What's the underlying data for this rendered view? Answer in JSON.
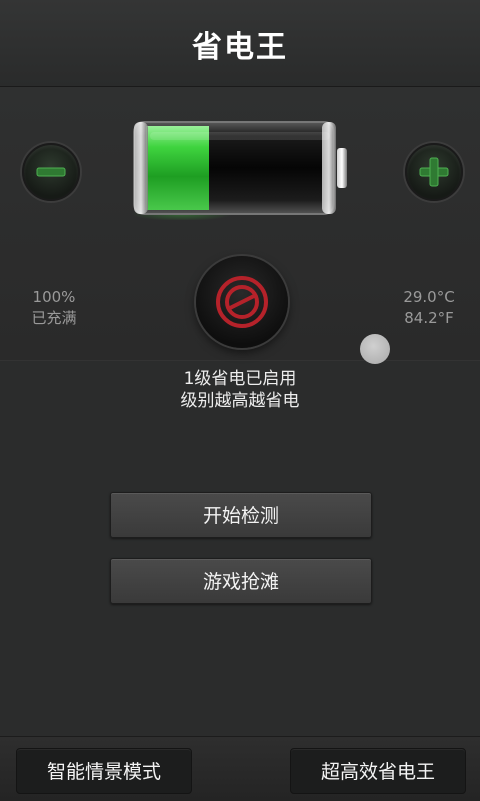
{
  "header": {
    "title": "省电王"
  },
  "battery": {
    "level_fraction": 1.0,
    "fill_fraction_shown": 0.34,
    "percent_text": "100%",
    "state_text": "已充满",
    "fill_color": "#39c83b"
  },
  "temperature": {
    "celsius": "29.0°C",
    "fahrenheit": "84.2°F"
  },
  "save_mode": {
    "line1": "1级省电已启用",
    "line2": "级别越高越省电"
  },
  "buttons": {
    "start_check": "开始检测",
    "game_mode": "游戏抢滩"
  },
  "footer": {
    "smart_scene": "智能情景模式",
    "super_saver": "超高效省电王"
  },
  "colors": {
    "accent_green": "#3fa83f",
    "power_red": "#c8252b"
  }
}
